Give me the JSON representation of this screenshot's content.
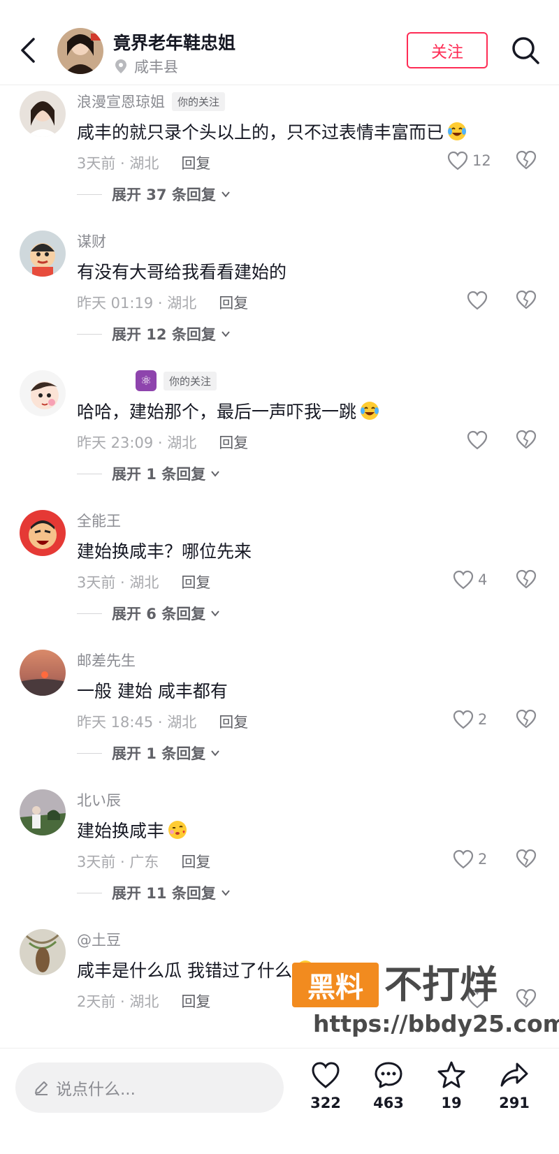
{
  "header": {
    "author_name": "竟界老年鞋忠姐",
    "location": "咸丰县",
    "follow_label": "关注"
  },
  "comments": [
    {
      "user": "浪漫宣恩琼姐",
      "tag": "你的关注",
      "text": "咸丰的就只录个头以上的，只不过表情丰富而已",
      "time": "3天前 · 湖北",
      "reply": "回复",
      "likes": "12",
      "expand": "展开 37 条回复"
    },
    {
      "user": "谋财",
      "tag": "",
      "text": "有没有大哥给我看看建始的",
      "time": "昨天 01:19 · 湖北",
      "reply": "回复",
      "likes": "",
      "expand": "展开 12 条回复"
    },
    {
      "user": "",
      "tag": "你的关注",
      "text": "哈哈，建始那个，最后一声吓我一跳",
      "time": "昨天 23:09 · 湖北",
      "reply": "回复",
      "likes": "",
      "expand": "展开 1 条回复"
    },
    {
      "user": "全能王",
      "tag": "",
      "text": "建始换咸丰？哪位先来",
      "time": "3天前 · 湖北",
      "reply": "回复",
      "likes": "4",
      "expand": "展开 6 条回复"
    },
    {
      "user": "邮差先生",
      "tag": "",
      "text": "一般 建始 咸丰都有",
      "time": "昨天 18:45 · 湖北",
      "reply": "回复",
      "likes": "2",
      "expand": "展开 1 条回复"
    },
    {
      "user": "北い辰",
      "tag": "",
      "text": "建始换咸丰",
      "time": "3天前 · 广东",
      "reply": "回复",
      "likes": "2",
      "expand": "展开 11 条回复"
    },
    {
      "user": "@土豆",
      "tag": "",
      "text": "咸丰是什么瓜 我错过了什么",
      "time": "2天前 · 湖北",
      "reply": "回复",
      "likes": "",
      "expand": ""
    }
  ],
  "watermark": {
    "box": "黑料",
    "title": "不打烊",
    "url": "https://bbdy25.com"
  },
  "bottom": {
    "placeholder": "说点什么...",
    "like_count": "322",
    "comment_count": "463",
    "fav_count": "19",
    "share_count": "291"
  },
  "colors": {
    "accent": "#fe2c55",
    "watermark_orange": "#f28b1f"
  }
}
